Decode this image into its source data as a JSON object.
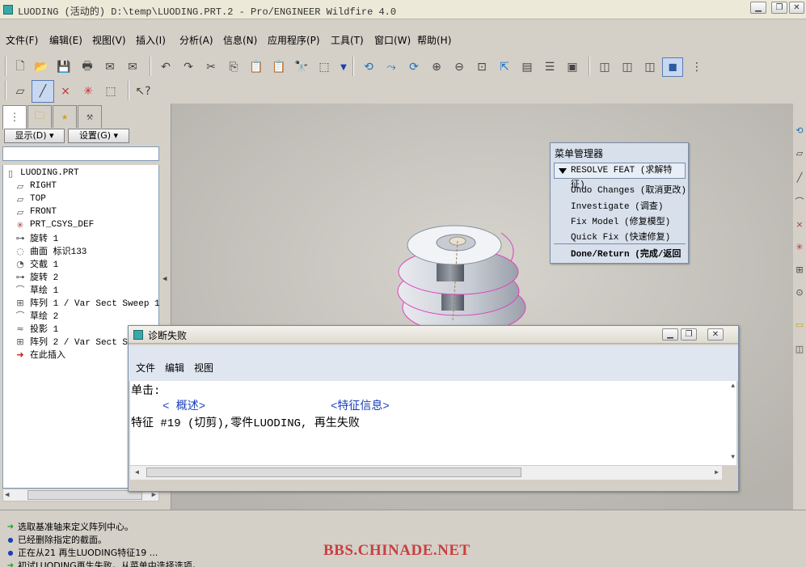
{
  "window": {
    "title": "LUODING (活动的) D:\\temp\\LUODING.PRT.2 - Pro/ENGINEER Wildfire 4.0"
  },
  "menubar": [
    "文件(F)",
    "编辑(E)",
    "视图(V)",
    "插入(I)",
    "分析(A)",
    "信息(N)",
    "应用程序(P)",
    "工具(T)",
    "窗口(W)",
    "帮助(H)"
  ],
  "panel": {
    "show_label": "显示(D) ▾",
    "settings_label": "设置(G) ▾"
  },
  "tree": [
    {
      "icon": "part-icon",
      "glyph": "▯",
      "label": "LUODING.PRT"
    },
    {
      "icon": "datum-plane-icon",
      "glyph": "▱",
      "label": "RIGHT"
    },
    {
      "icon": "datum-plane-icon",
      "glyph": "▱",
      "label": "TOP"
    },
    {
      "icon": "datum-plane-icon",
      "glyph": "▱",
      "label": "FRONT"
    },
    {
      "icon": "csys-icon",
      "glyph": "✳",
      "label": "PRT_CSYS_DEF"
    },
    {
      "icon": "revolve-icon",
      "glyph": "⊶",
      "label": "旋转 1"
    },
    {
      "icon": "surface-icon",
      "glyph": "◌",
      "label": "曲面 标识133"
    },
    {
      "icon": "intersect-icon",
      "glyph": "◔",
      "label": "交截 1"
    },
    {
      "icon": "revolve-icon",
      "glyph": "⊶",
      "label": "旋转 2"
    },
    {
      "icon": "sketch-icon",
      "glyph": "⌒",
      "label": "草绘 1"
    },
    {
      "icon": "pattern-icon",
      "glyph": "⊞",
      "label": "阵列 1 / Var Sect Sweep 1"
    },
    {
      "icon": "sketch-icon",
      "glyph": "⌒",
      "label": "草绘 2"
    },
    {
      "icon": "project-icon",
      "glyph": "≈",
      "label": "投影 1"
    },
    {
      "icon": "pattern-icon",
      "glyph": "⊞",
      "label": "阵列 2 / Var Sect Sw"
    },
    {
      "icon": "insert-here-icon",
      "glyph": "➜",
      "label": "在此插入"
    }
  ],
  "menu_manager": {
    "title": "菜单管理器",
    "header": "RESOLVE FEAT (求解特征)",
    "items": [
      "Undo Changes (取消更改)",
      "Investigate (调查)",
      "Fix Model (修复模型)",
      "Quick Fix (快速修复)"
    ],
    "done": "Done/Return (完成/返回"
  },
  "diagnostic": {
    "title": "诊断失败",
    "menu": [
      "文件",
      "编辑",
      "视图"
    ],
    "click_label": "单击:",
    "overview_link": "< 概述>",
    "feature_info_link": "<特征信息>",
    "message": "特征 #19 (切剪),零件LUODING,   再生失败"
  },
  "status_lines": [
    {
      "icon": "arrow-icon",
      "text": "选取基准轴来定义阵列中心。"
    },
    {
      "icon": "info-dot-icon",
      "text": "已经删除指定的截面。"
    },
    {
      "icon": "info-dot-icon",
      "text": "正在从21 再生LUODING特征19 ..."
    },
    {
      "icon": "arrow-icon",
      "text": "初试LUODING再生失败。从菜单中选择选项。"
    }
  ],
  "watermark": "BBS.CHINADE.NET",
  "colors": {
    "accent": "#3aa8a8",
    "link": "#1a3fb8",
    "watermark": "#c84040",
    "curve": "#e040c0"
  }
}
